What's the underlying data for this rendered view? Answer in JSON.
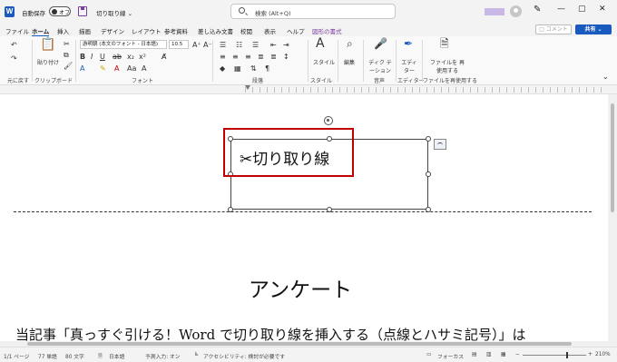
{
  "titlebar": {
    "app_icon": "W",
    "autosave_label": "自動保存",
    "autosave_state": "オフ",
    "doc_title": "切り取り線 ⌄",
    "search_placeholder": "検索 (Alt+Q)",
    "pen_icon": "✎",
    "minimize": "—",
    "maximize": "▢",
    "close": "✕"
  },
  "tabs": {
    "items": [
      "ファイル",
      "ホーム",
      "挿入",
      "描画",
      "デザイン",
      "レイアウト",
      "参考資料",
      "差し込み文書",
      "校閲",
      "表示",
      "ヘルプ",
      "図形の書式"
    ],
    "active": "ホーム",
    "comment": "□ コメント",
    "share": "共有 ⌄"
  },
  "ribbon": {
    "undo_group": "元に戻す",
    "clipboard": {
      "paste": "貼り付け",
      "label": "クリップボード"
    },
    "font": {
      "name": "游明朝 (本文のフォント - 日本語)",
      "size": "10.5",
      "label": "フォント"
    },
    "paragraph": {
      "label": "段落"
    },
    "style": {
      "styles": "スタイル",
      "label": "スタイル"
    },
    "editing": {
      "edit": "編集"
    },
    "voice": {
      "dictation": "ディク テーション",
      "label": "音声"
    },
    "editor": {
      "editor": "エディ ター",
      "label": "エディター"
    },
    "reuse": {
      "reuse": "ファイルを 再使用する",
      "label": "ファイルを再使用する"
    }
  },
  "document": {
    "cut_line_text": "✂切り取り線",
    "heading": "アンケート",
    "body": "当記事「真っすぐ引ける！Word で切り取り線を挿入する（点線とハサミ記号）」は"
  },
  "statusbar": {
    "page": "1/1 ページ",
    "words": "77 単語",
    "chars": "80 文字",
    "language": "日本語",
    "predict": "予測入力: オン",
    "accessibility": "アクセシビリティ: 検討が必要です",
    "focus": "フォーカス",
    "zoom": "210%"
  },
  "colors": {
    "accent": "#185abd",
    "highlight_box": "#c00000",
    "context_tab": "#7a3fa0"
  }
}
